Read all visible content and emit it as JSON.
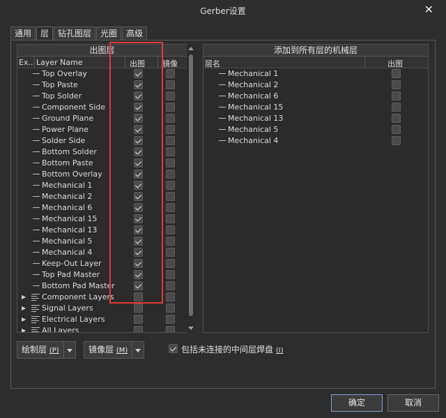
{
  "window": {
    "title": "Gerber设置",
    "close_glyph": "✕"
  },
  "tabs": [
    {
      "label": "通用",
      "active": false
    },
    {
      "label": "层",
      "active": true
    },
    {
      "label": "钻孔图层",
      "active": false
    },
    {
      "label": "光圈",
      "active": false
    },
    {
      "label": "高级",
      "active": false
    }
  ],
  "left_panel": {
    "title": "出图层",
    "columns": {
      "expand": "Ex...",
      "name": "Layer Name",
      "plot": "出图",
      "mirror": "镜像"
    },
    "layers": [
      {
        "name": "Top Overlay",
        "plot": true,
        "mirror": false
      },
      {
        "name": "Top Paste",
        "plot": true,
        "mirror": false
      },
      {
        "name": "Top Solder",
        "plot": true,
        "mirror": false
      },
      {
        "name": "Component Side",
        "plot": true,
        "mirror": false
      },
      {
        "name": "Ground Plane",
        "plot": true,
        "mirror": false
      },
      {
        "name": "Power Plane",
        "plot": true,
        "mirror": false
      },
      {
        "name": "Solder Side",
        "plot": true,
        "mirror": false
      },
      {
        "name": "Bottom Solder",
        "plot": true,
        "mirror": false
      },
      {
        "name": "Bottom Paste",
        "plot": true,
        "mirror": false
      },
      {
        "name": "Bottom Overlay",
        "plot": true,
        "mirror": false
      },
      {
        "name": "Mechanical 1",
        "plot": true,
        "mirror": false
      },
      {
        "name": "Mechanical 2",
        "plot": true,
        "mirror": false
      },
      {
        "name": "Mechanical 6",
        "plot": true,
        "mirror": false
      },
      {
        "name": "Mechanical 15",
        "plot": true,
        "mirror": false
      },
      {
        "name": "Mechanical 13",
        "plot": true,
        "mirror": false
      },
      {
        "name": "Mechanical 5",
        "plot": true,
        "mirror": false
      },
      {
        "name": "Mechanical 4",
        "plot": true,
        "mirror": false
      },
      {
        "name": "Keep-Out Layer",
        "plot": true,
        "mirror": false
      },
      {
        "name": "Top Pad Master",
        "plot": true,
        "mirror": false
      },
      {
        "name": "Bottom Pad Master",
        "plot": true,
        "mirror": false
      }
    ],
    "groups": [
      {
        "name": "Component Layers",
        "plot": false,
        "mirror": false
      },
      {
        "name": "Signal Layers",
        "plot": false,
        "mirror": false
      },
      {
        "name": "Electrical Layers",
        "plot": false,
        "mirror": false
      },
      {
        "name": "All Layers",
        "plot": false,
        "mirror": false
      }
    ]
  },
  "right_panel": {
    "title": "添加到所有层的机械层",
    "columns": {
      "name": "层名",
      "plot": "出图"
    },
    "layers": [
      {
        "name": "Mechanical 1",
        "plot": false
      },
      {
        "name": "Mechanical 2",
        "plot": false
      },
      {
        "name": "Mechanical 6",
        "plot": false
      },
      {
        "name": "Mechanical 15",
        "plot": false
      },
      {
        "name": "Mechanical 13",
        "plot": false
      },
      {
        "name": "Mechanical 5",
        "plot": false
      },
      {
        "name": "Mechanical 4",
        "plot": false
      }
    ]
  },
  "bottom": {
    "plot_layers_label": "绘制层",
    "plot_layers_key": "(P)",
    "mirror_layers_label": "镜像层",
    "mirror_layers_key": "(M)",
    "include_label": "包括未连接的中间层焊盘",
    "include_key": "(I)",
    "include_checked": true
  },
  "buttons": {
    "ok": "确定",
    "cancel": "取消"
  },
  "colors": {
    "highlight_box": "#e03a3a",
    "background": "#2d2d2d"
  }
}
